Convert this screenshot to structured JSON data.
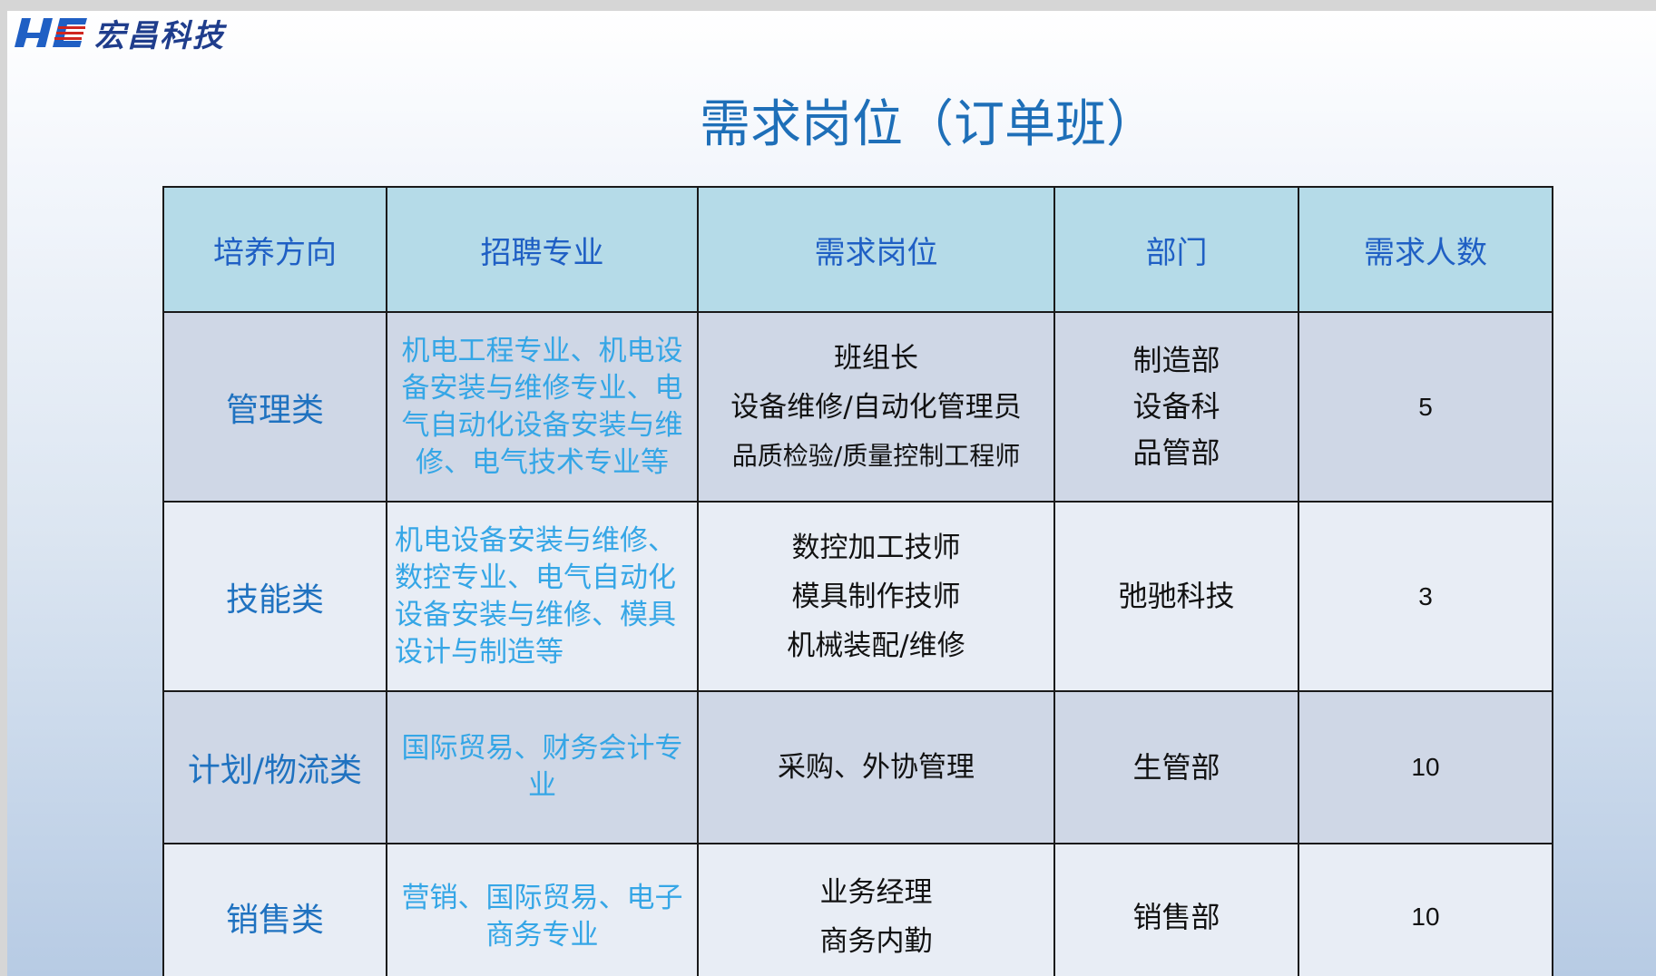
{
  "logo": {
    "text": "宏昌科技",
    "mark_color": "#1f5fc4",
    "accent": "#d0261f"
  },
  "title": "需求岗位（订单班）",
  "table": {
    "headers": [
      "培养方向",
      "招聘专业",
      "需求岗位",
      "部门",
      "需求人数"
    ],
    "rows": [
      {
        "direction": "管理类",
        "major": "机电工程专业、机电设备安装与维修专业、电气自动化设备安装与维修、电气技术专业等",
        "positions": [
          "班组长",
          "设备维修/自动化管理员",
          "品质检验/质量控制工程师"
        ],
        "departments": [
          "制造部",
          "设备科",
          "品管部"
        ],
        "count": "5"
      },
      {
        "direction": "技能类",
        "major": "机电设备安装与维修、数控专业、电气自动化设备安装与维修、模具设计与制造等",
        "positions": [
          "数控加工技师",
          "模具制作技师",
          "机械装配/维修"
        ],
        "departments": [
          "弛驰科技"
        ],
        "count": "3"
      },
      {
        "direction": "计划/物流类",
        "major": "国际贸易、财务会计专业",
        "positions": [
          "采购、外协管理"
        ],
        "departments": [
          "生管部"
        ],
        "count": "10"
      },
      {
        "direction": "销售类",
        "major": "营销、国际贸易、电子商务专业",
        "positions": [
          "业务经理",
          "商务内勤"
        ],
        "departments": [
          "销售部"
        ],
        "count": "10"
      }
    ]
  }
}
